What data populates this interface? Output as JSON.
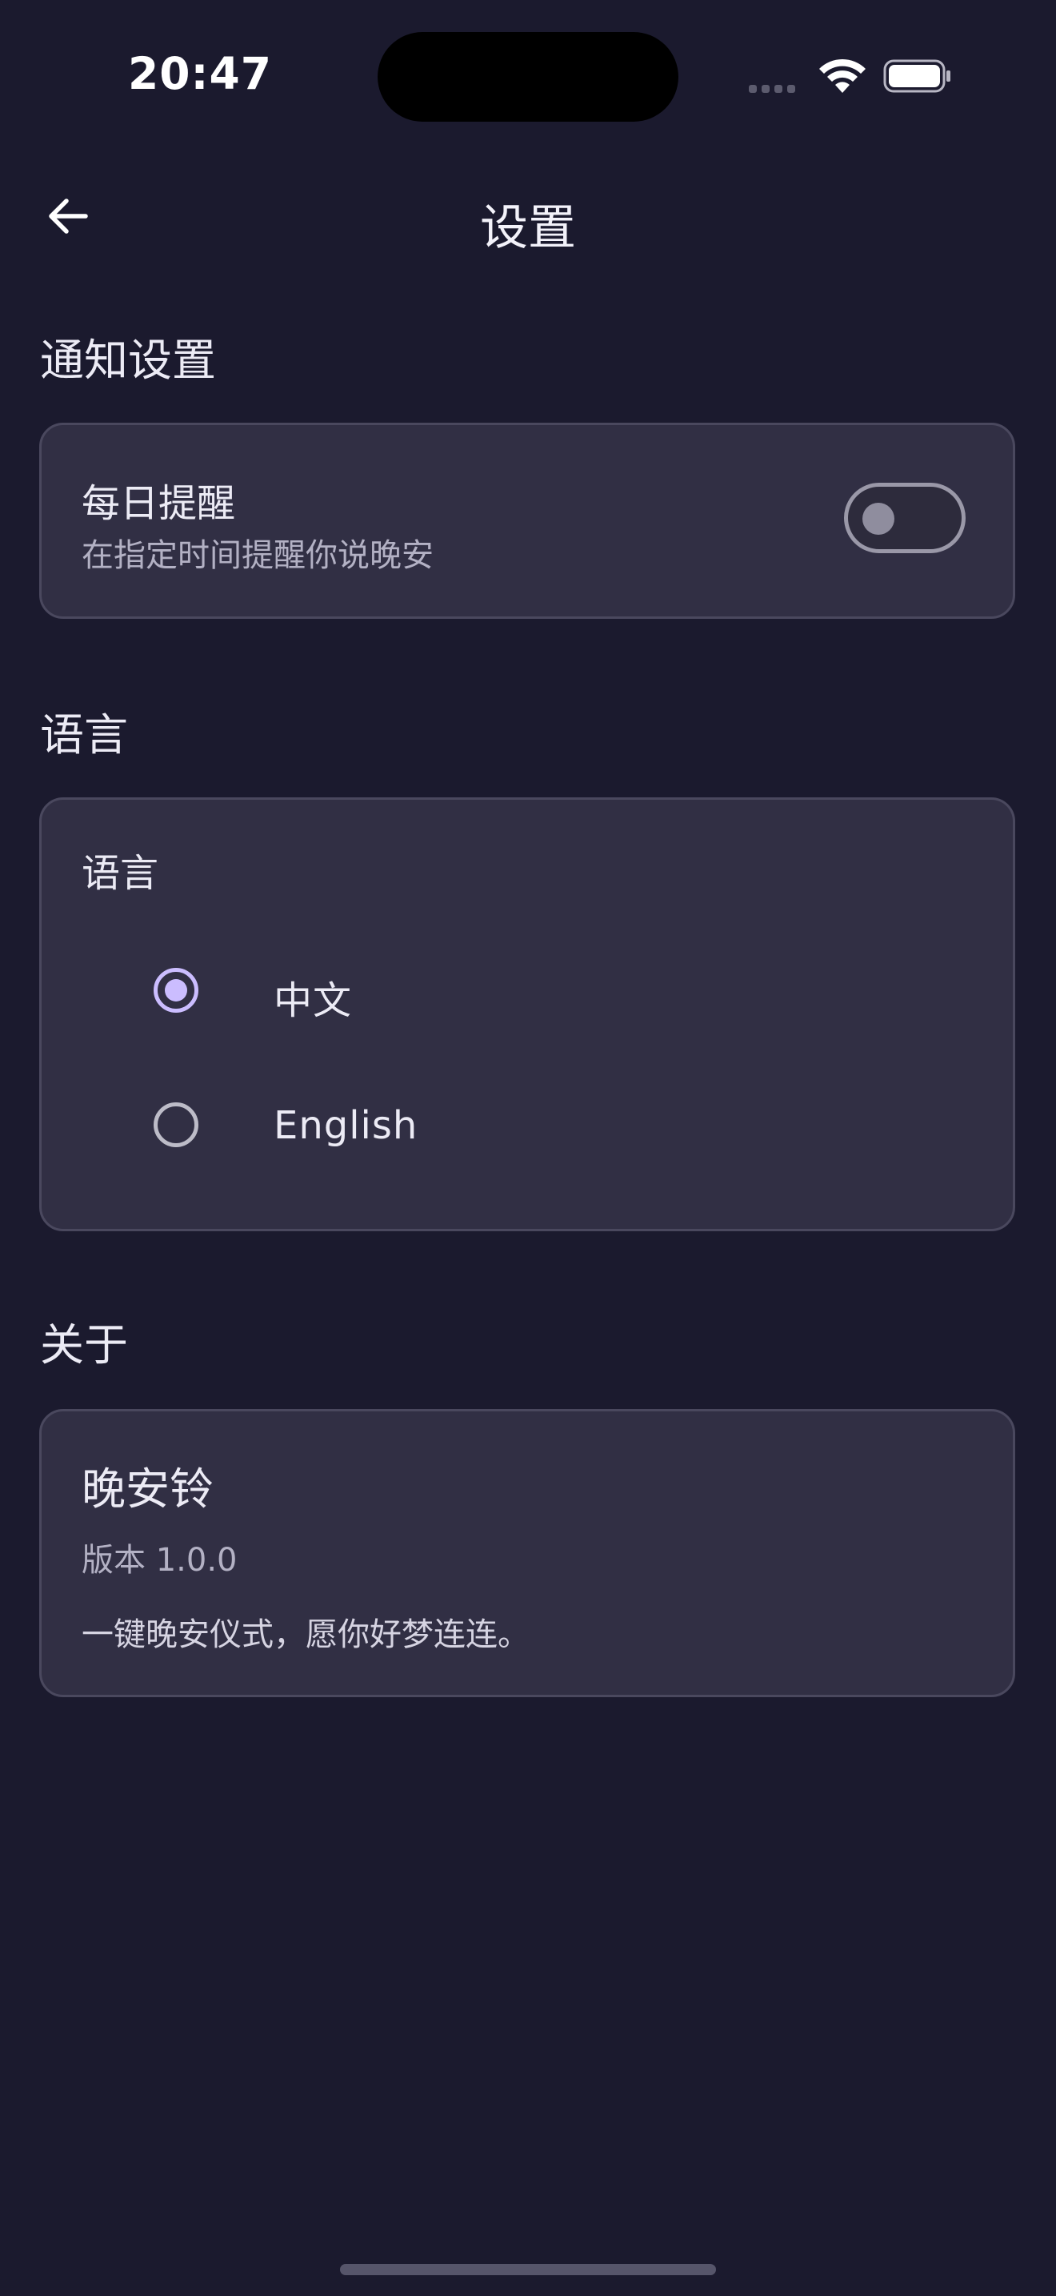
{
  "status_bar": {
    "time": "20:47"
  },
  "header": {
    "title": "设置",
    "back_icon": "arrow-left-icon"
  },
  "notifications": {
    "section_title": "通知设置",
    "daily_reminder": {
      "title": "每日提醒",
      "subtitle": "在指定时间提醒你说晚安",
      "enabled": false
    }
  },
  "language": {
    "section_title": "语言",
    "card_title": "语言",
    "options": [
      {
        "label": "中文",
        "selected": true
      },
      {
        "label": "English",
        "selected": false
      }
    ]
  },
  "about": {
    "section_title": "关于",
    "app_name": "晚安铃",
    "version": "版本 1.0.0",
    "description": "一键晚安仪式，愿你好梦连连。"
  },
  "colors": {
    "background": "#1b1a2e",
    "card": "#312f44",
    "accent": "#cbbdff"
  }
}
